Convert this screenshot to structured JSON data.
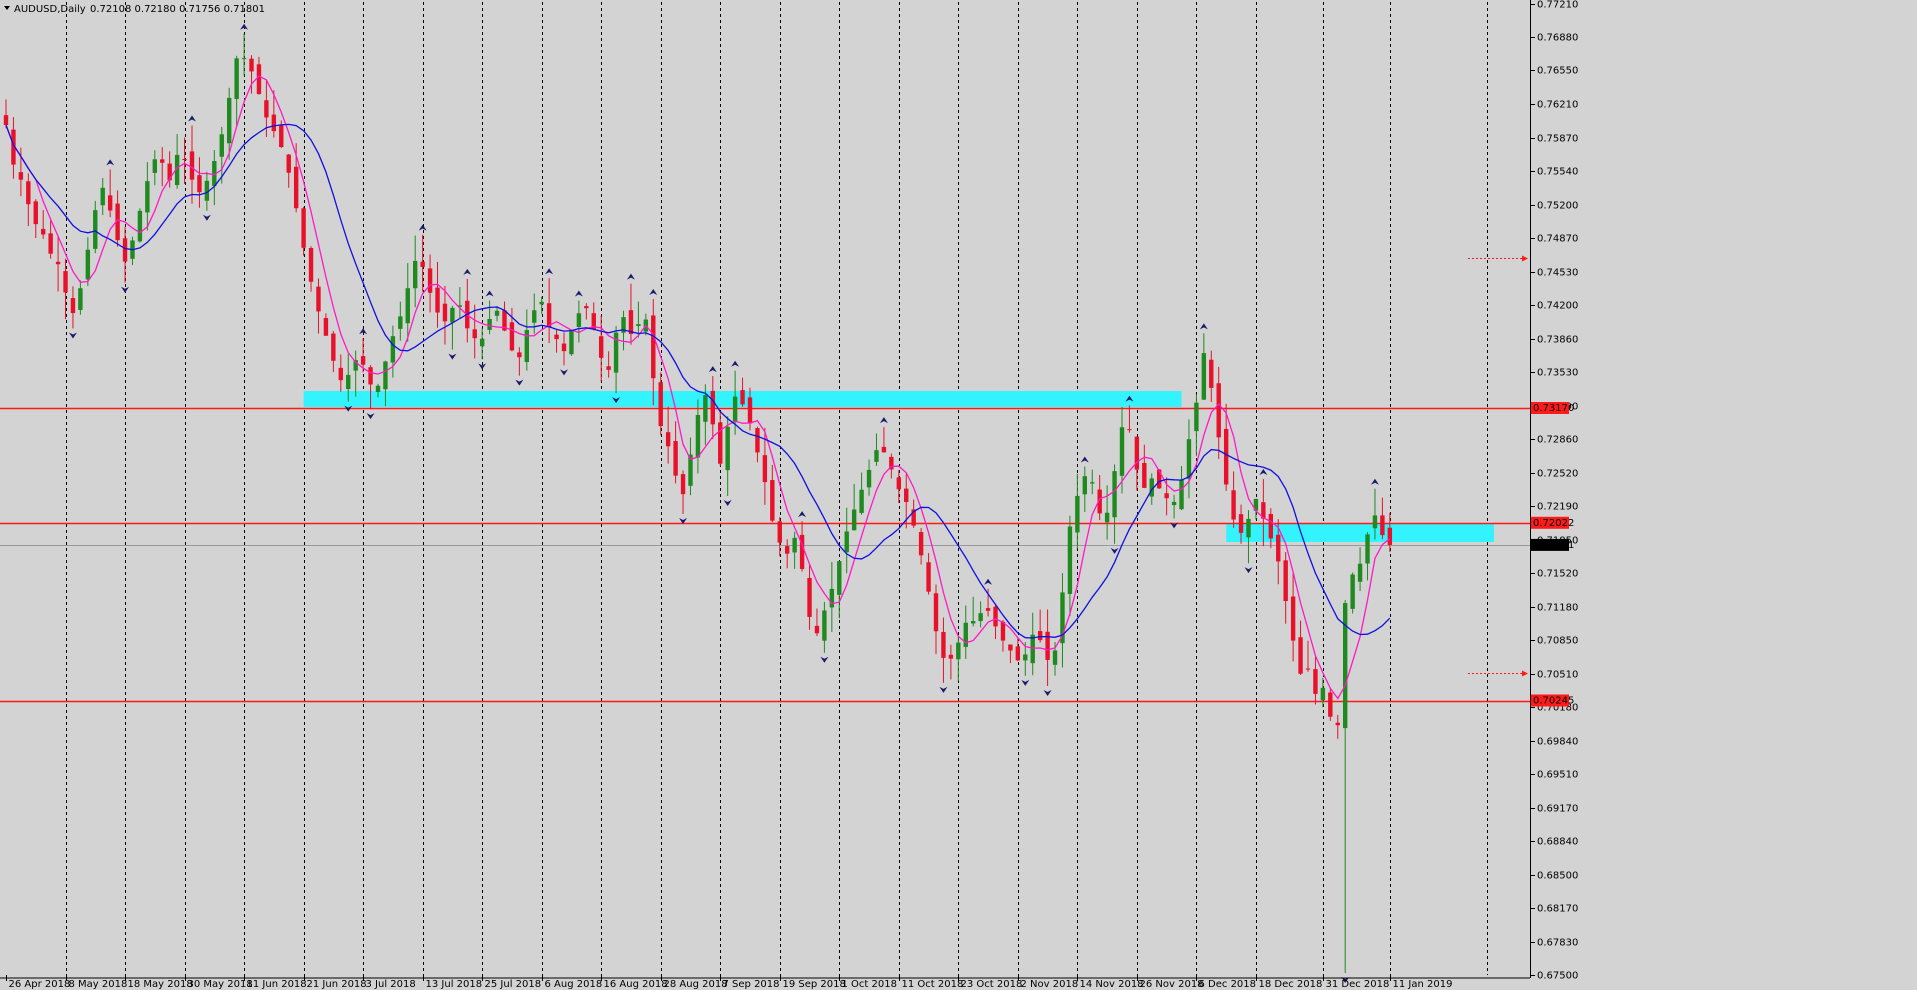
{
  "window": {
    "title_symbol": "AUDUSD,Daily",
    "ohlc": "0.72108 0.72180 0.71756 0.71801"
  },
  "colors": {
    "background": "#d3d3d3",
    "bull": "#1f8a1f",
    "bear": "#e8102a",
    "ma_fast": "#ff19c8",
    "ma_slow": "#1010e0",
    "zone": "#33f3ff",
    "level": "#ff1a1a",
    "fractal": "#1a1a6b"
  },
  "chart_data": {
    "type": "candlestick",
    "title": "AUDUSD,Daily",
    "ylim": [
      0.675,
      0.7721
    ],
    "y_ticks": [
      "0.77210",
      "0.76880",
      "0.76550",
      "0.76210",
      "0.75870",
      "0.75540",
      "0.75200",
      "0.74870",
      "0.74530",
      "0.74200",
      "0.73860",
      "0.73530",
      "0.73190",
      "0.72860",
      "0.72520",
      "0.72190",
      "0.71850",
      "0.71520",
      "0.71180",
      "0.70850",
      "0.70510",
      "0.70180",
      "0.69840",
      "0.69510",
      "0.69170",
      "0.68840",
      "0.68500",
      "0.68170",
      "0.67830",
      "0.67500"
    ],
    "x_ticks": [
      "26 Apr 2018",
      "8 May 2018",
      "18 May 2018",
      "30 May 2018",
      "11 Jun 2018",
      "21 Jun 2018",
      "3 Jul 2018",
      "13 Jul 2018",
      "25 Jul 2018",
      "6 Aug 2018",
      "16 Aug 2018",
      "28 Aug 2018",
      "7 Sep 2018",
      "19 Sep 2018",
      "1 Oct 2018",
      "11 Oct 2018",
      "23 Oct 2018",
      "2 Nov 2018",
      "14 Nov 2018",
      "26 Nov 2018",
      "6 Dec 2018",
      "18 Dec 2018",
      "31 Dec 2018",
      "11 Jan 2019"
    ],
    "price_levels": [
      {
        "price": 0.7317,
        "label": "0.73170"
      },
      {
        "price": 0.72022,
        "label": "0.72022"
      },
      {
        "price": 0.70245,
        "label": "0.70245"
      }
    ],
    "current_price": {
      "price": 0.71801,
      "label": "0.71801"
    },
    "zones": [
      {
        "from_date": "21 Jun 2018",
        "to_date": "4 Dec 2018",
        "low": 0.7318,
        "high": 0.7334
      },
      {
        "from_date": "12 Dec 2018",
        "to_date": "31 Jan 2019",
        "low": 0.7183,
        "high": 0.7202
      }
    ],
    "anchor_dates": [
      "26 Apr 2018",
      "11 Jan 2019"
    ],
    "anchor_closes": [
      0.76,
      0.718
    ],
    "waypoints": [
      [
        0.76,
        0.756,
        0.7545,
        0.752,
        0.75,
        0.749,
        0.747,
        0.746,
        0.743,
        0.741
      ],
      [
        0.744,
        0.748,
        0.752,
        0.754,
        0.751,
        0.748,
        0.746,
        0.749,
        0.752,
        0.755
      ],
      [
        0.757,
        0.756,
        0.754,
        0.758,
        0.756,
        0.754,
        0.753,
        0.755,
        0.757,
        0.76
      ],
      [
        0.764,
        0.768,
        0.766,
        0.765,
        0.762,
        0.76,
        0.759,
        0.757,
        0.754,
        0.75
      ],
      [
        0.746,
        0.743,
        0.74,
        0.738,
        0.735,
        0.734,
        0.736,
        0.737,
        0.735,
        0.733
      ],
      [
        0.735,
        0.738,
        0.74,
        0.742,
        0.746,
        0.747,
        0.744,
        0.742,
        0.74,
        0.741
      ],
      [
        0.743,
        0.74,
        0.739,
        0.738,
        0.74,
        0.742,
        0.74,
        0.738,
        0.736,
        0.739
      ],
      [
        0.741,
        0.743,
        0.74,
        0.739,
        0.737,
        0.739,
        0.741,
        0.742,
        0.74,
        0.737
      ],
      [
        0.735,
        0.739,
        0.741,
        0.739,
        0.74,
        0.741,
        0.735,
        0.73,
        0.728,
        0.725
      ],
      [
        0.723,
        0.727,
        0.731,
        0.733,
        0.73,
        0.726,
        0.73,
        0.733,
        0.732,
        0.73
      ],
      [
        0.727,
        0.724,
        0.72,
        0.718,
        0.717,
        0.719,
        0.715,
        0.71,
        0.709,
        0.712
      ],
      [
        0.714,
        0.717,
        0.72,
        0.722,
        0.724,
        0.726,
        0.728,
        0.727,
        0.725,
        0.723
      ],
      [
        0.722,
        0.719,
        0.716,
        0.712,
        0.708,
        0.706,
        0.707,
        0.709,
        0.711,
        0.71
      ],
      [
        0.712,
        0.711,
        0.709,
        0.708,
        0.707,
        0.706,
        0.708,
        0.71,
        0.707,
        0.706
      ],
      [
        0.709,
        0.718,
        0.722,
        0.724,
        0.726,
        0.722,
        0.72,
        0.723,
        0.729,
        0.731
      ],
      [
        0.727,
        0.723,
        0.725,
        0.724,
        0.723,
        0.722,
        0.723,
        0.728,
        0.73,
        0.738
      ],
      [
        0.735,
        0.73,
        0.725,
        0.721,
        0.719,
        0.72,
        0.723,
        0.721,
        0.719,
        0.717
      ],
      [
        0.713,
        0.709,
        0.705,
        0.706,
        0.703,
        0.704,
        0.701,
        0.699,
        0.712,
        0.715
      ],
      [
        0.716,
        0.719,
        0.721,
        0.719,
        0.718
      ]
    ],
    "indicators": [
      {
        "name": "",
        "type": "moving_average",
        "color": "#ff19c8"
      },
      {
        "name": "",
        "type": "moving_average",
        "color": "#1010e0"
      }
    ],
    "grid": "vertical dashed at date labels",
    "fractals": true
  }
}
